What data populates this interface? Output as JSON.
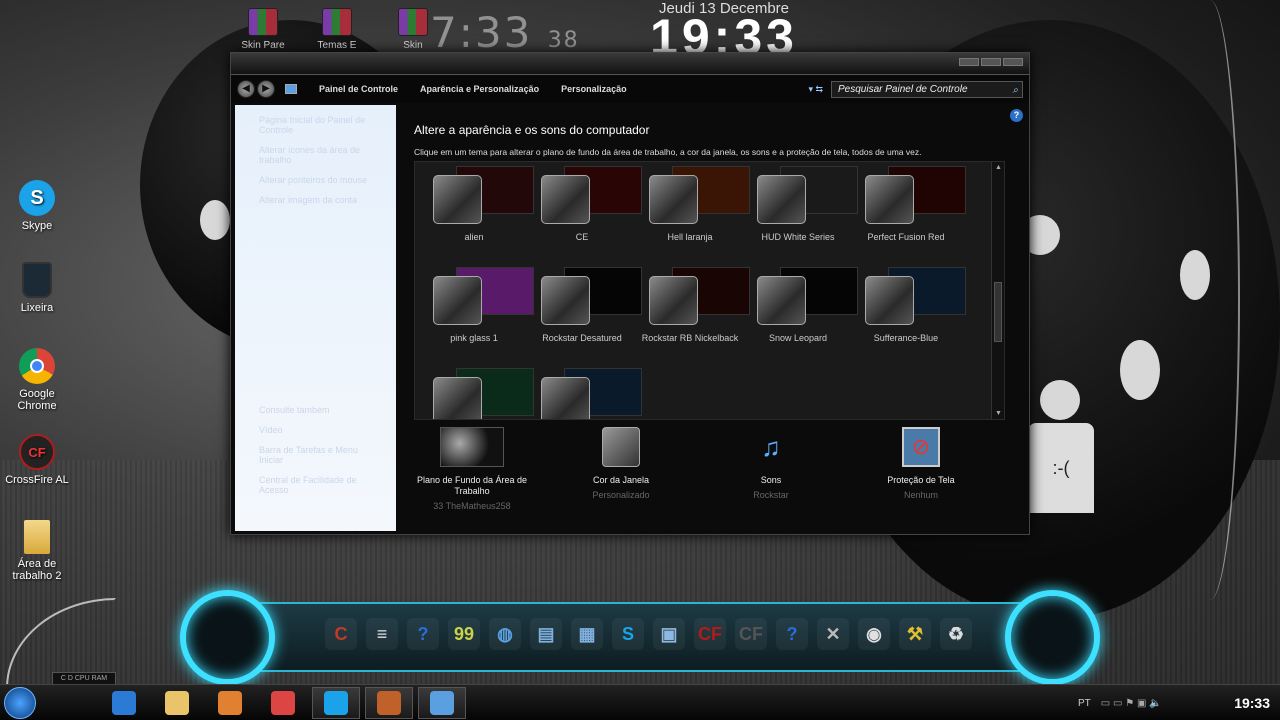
{
  "desktop": {
    "top_icons": [
      {
        "label": "Skin Pare",
        "icon": "winrar-icon"
      },
      {
        "label": "Temas E",
        "icon": "winrar-icon"
      },
      {
        "label": "Skin",
        "icon": "winrar-icon"
      }
    ],
    "clock_small": {
      "time": "7:33",
      "seconds": "38"
    },
    "clock_big": {
      "date": "Jeudi 13 Decembre",
      "time": "19:33"
    },
    "icons": [
      {
        "label": "Skype",
        "icon": "skype-icon",
        "color": "#1aa3e8",
        "glyph": "S"
      },
      {
        "label": "Lixeira",
        "icon": "trash-icon",
        "color": "#1c2a36",
        "glyph": ""
      },
      {
        "label": "Google Chrome",
        "icon": "chrome-icon",
        "color": "#e0e0e0",
        "glyph": "◉"
      },
      {
        "label": "CrossFire AL",
        "icon": "crossfire-icon",
        "color": "#b31b1b",
        "glyph": "CF"
      },
      {
        "label": "Área de trabalho 2",
        "icon": "folder-icon",
        "color": "#e9c46a",
        "glyph": ""
      }
    ],
    "cpu_label": "C   D   CPU RAM"
  },
  "window": {
    "breadcrumbs": [
      "Painel de Controle",
      "Aparência e Personalização",
      "Personalização"
    ],
    "search_placeholder": "Pesquisar Painel de Controle",
    "sidebar": {
      "links": [
        "Página Inicial do Painel de Controle",
        "Alterar ícones da área de trabalho",
        "Alterar ponteiros do mouse",
        "Alterar imagem da conta"
      ],
      "see_also": "Consulte também",
      "see_also_links": [
        "Vídeo",
        "Barra de Tarefas e Menu Iniciar",
        "Central de Facilidade de Acesso"
      ]
    },
    "heading": "Altere a aparência e os sons do computador",
    "subheading": "Clique em um tema para alterar o plano de fundo da área de trabalho, a cor da janela, os sons e a proteção de tela, todos de uma vez.",
    "themes": [
      {
        "label": "alien",
        "preview": "#220808"
      },
      {
        "label": "CE",
        "preview": "#2a0505"
      },
      {
        "label": "Hell laranja",
        "preview": "#3a1405"
      },
      {
        "label": "HUD White Series",
        "preview": "#1a1a1a"
      },
      {
        "label": "Perfect Fusion Red",
        "preview": "#200404"
      },
      {
        "label": "pink glass 1",
        "preview": "#5a1a6a"
      },
      {
        "label": "Rockstar Desatured",
        "preview": "#050505"
      },
      {
        "label": "Rockstar RB Nickelback",
        "preview": "#1a0505"
      },
      {
        "label": "Snow Leopard",
        "preview": "#050505"
      },
      {
        "label": "Sufferance-Blue",
        "preview": "#0a1a2a"
      },
      {
        "label": "",
        "preview": "#0a2a1a"
      },
      {
        "label": "",
        "preview": "#0a1a2a"
      }
    ],
    "bottom": [
      {
        "name": "Plano de Fundo da Área de Trabalho",
        "value": "33 TheMatheus258"
      },
      {
        "name": "Cor da Janela",
        "value": "Personalizado"
      },
      {
        "name": "Sons",
        "value": "Rockstar"
      },
      {
        "name": "Proteção de Tela",
        "value": "Nenhum"
      }
    ]
  },
  "dock": {
    "items": [
      {
        "icon": "ccleaner-icon",
        "glyph": "C",
        "color": "#c0392b"
      },
      {
        "icon": "notepad-icon",
        "glyph": "≡",
        "color": "#e0e0e0"
      },
      {
        "icon": "help-icon",
        "glyph": "?",
        "color": "#2b6cd6"
      },
      {
        "icon": "monitor-icon",
        "glyph": "99",
        "color": "#cbd34a"
      },
      {
        "icon": "network-icon",
        "glyph": "◍",
        "color": "#5aa0e0"
      },
      {
        "icon": "documents-icon",
        "glyph": "▤",
        "color": "#7fb0e0"
      },
      {
        "icon": "folder-icon",
        "glyph": "▦",
        "color": "#7fb0e0"
      },
      {
        "icon": "skype-icon",
        "glyph": "S",
        "color": "#1aa3e8"
      },
      {
        "icon": "control-panel-icon",
        "glyph": "▣",
        "color": "#8fb8e0"
      },
      {
        "icon": "crossfire-icon",
        "glyph": "CF",
        "color": "#b31b1b"
      },
      {
        "icon": "crossfire-alt-icon",
        "glyph": "CF",
        "color": "#555"
      },
      {
        "icon": "help-alt-icon",
        "glyph": "?",
        "color": "#2b6cd6"
      },
      {
        "icon": "tools-icon",
        "glyph": "✕",
        "color": "#bbb"
      },
      {
        "icon": "chrome-icon",
        "glyph": "◉",
        "color": "#e0e0e0"
      },
      {
        "icon": "wrench-icon",
        "glyph": "⚒",
        "color": "#e0c030"
      },
      {
        "icon": "recycle-bin-icon",
        "glyph": "♻",
        "color": "#ddd"
      }
    ]
  },
  "taskbar": {
    "apps": [
      {
        "icon": "ie-icon",
        "color": "#2b7bd6",
        "active": false
      },
      {
        "icon": "explorer-icon",
        "color": "#e9c46a",
        "active": false
      },
      {
        "icon": "media-player-icon",
        "color": "#e08030",
        "active": false
      },
      {
        "icon": "chrome-icon",
        "color": "#d44",
        "active": false
      },
      {
        "icon": "skype-icon",
        "color": "#1aa3e8",
        "active": true
      },
      {
        "icon": "baseball-glove-icon",
        "color": "#c0602a",
        "active": true
      },
      {
        "icon": "control-panel-icon",
        "color": "#5aa0e0",
        "active": true
      }
    ],
    "lang": "PT",
    "time": "19:33"
  }
}
